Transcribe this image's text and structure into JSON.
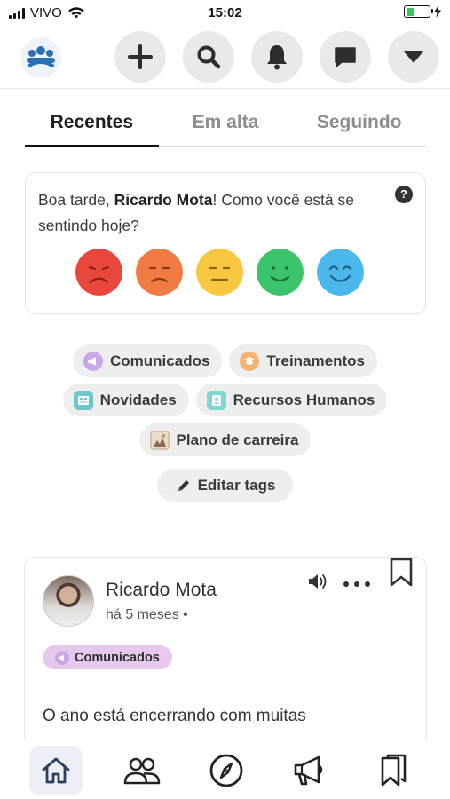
{
  "status_bar": {
    "carrier": "VIVO",
    "time": "15:02",
    "battery_level": 0.35
  },
  "tabs": [
    {
      "label": "Recentes",
      "active": true
    },
    {
      "label": "Em alta",
      "active": false
    },
    {
      "label": "Seguindo",
      "active": false
    }
  ],
  "mood": {
    "greeting_prefix": "Boa tarde, ",
    "user_name": "Ricardo Mota",
    "greeting_suffix": "! Como você está se sentindo hoje?",
    "help_icon": "?",
    "faces": [
      {
        "name": "very-sad",
        "color": "#e9473b"
      },
      {
        "name": "sad",
        "color": "#f27b43"
      },
      {
        "name": "neutral",
        "color": "#f8c740"
      },
      {
        "name": "happy",
        "color": "#3cc46c"
      },
      {
        "name": "very-happy",
        "color": "#4bb8ec"
      }
    ]
  },
  "tags": [
    {
      "label": "Comunicados",
      "icon": "megaphone-icon",
      "color": "#c9a7e8"
    },
    {
      "label": "Treinamentos",
      "icon": "graduation-cap-icon",
      "color": "#f5b36f"
    },
    {
      "label": "Novidades",
      "icon": "newspaper-icon",
      "color": "#6cc7cf"
    },
    {
      "label": "Recursos Humanos",
      "icon": "id-badge-icon",
      "color": "#7fd6d3"
    },
    {
      "label": "Plano de carreira",
      "icon": "career-image-icon",
      "color": "#d9c1a5"
    }
  ],
  "edit_tags_label": "Editar tags",
  "post": {
    "author": "Ricardo Mota",
    "time": "há 5 meses •",
    "tag": "Comunicados",
    "tag_color": "#e7c9ef",
    "body": "O ano está encerrando com muitas"
  },
  "bottom_nav": [
    {
      "name": "home-icon",
      "active": true
    },
    {
      "name": "people-icon",
      "active": false
    },
    {
      "name": "compass-icon",
      "active": false
    },
    {
      "name": "megaphone-icon",
      "active": false
    },
    {
      "name": "bookmarks-icon",
      "active": false
    }
  ],
  "colors": {
    "accent": "#3a4f7a",
    "brand_logo": "#2b6fb5"
  }
}
